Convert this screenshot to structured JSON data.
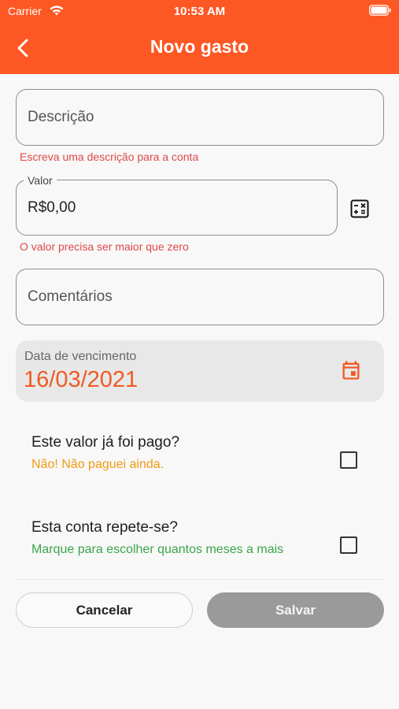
{
  "status_bar": {
    "carrier": "Carrier",
    "time": "10:53 AM"
  },
  "header": {
    "title": "Novo gasto",
    "back_icon": "chevron-left-icon"
  },
  "colors": {
    "header_bg": "#fd5723",
    "accent": "#f05a24",
    "error": "#e04848",
    "warning": "#f29a12",
    "success": "#3aa64a",
    "disabled_button": "#9a9a9a"
  },
  "form": {
    "description": {
      "placeholder": "Descrição",
      "helper": "Escreva uma descrição para a conta"
    },
    "value": {
      "label": "Valor",
      "value": "R$0,00",
      "helper": "O valor precisa ser maior que zero",
      "calculator_icon": "calculator-icon"
    },
    "comments": {
      "placeholder": "Comentários"
    },
    "due_date": {
      "label": "Data de vencimento",
      "value": "16/03/2021",
      "icon": "calendar-icon"
    },
    "paid": {
      "title": "Este valor já foi pago?",
      "subtitle": "Não! Não paguei ainda.",
      "checked": false
    },
    "repeat": {
      "title": "Esta conta repete-se?",
      "subtitle": "Marque para escolher quantos meses a mais",
      "checked": false
    }
  },
  "actions": {
    "cancel": "Cancelar",
    "save": "Salvar"
  }
}
